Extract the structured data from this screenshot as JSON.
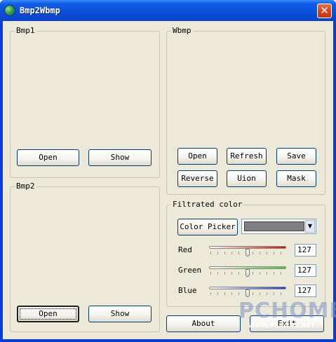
{
  "window": {
    "title": "Bmp2Wbmp",
    "close_glyph": "✕"
  },
  "bmp1": {
    "label": "Bmp1",
    "open_label": "Open",
    "show_label": "Show"
  },
  "bmp2": {
    "label": "Bmp2",
    "open_label": "Open",
    "show_label": "Show"
  },
  "wbmp": {
    "label": "Wbmp",
    "open_label": "Open",
    "refresh_label": "Refresh",
    "save_label": "Save",
    "reverse_label": "Reverse",
    "union_label": "Uion",
    "mask_label": "Mask"
  },
  "filter": {
    "label": "Filtrated color",
    "color_picker_label": "Color Picker",
    "swatch_color": "#808080",
    "dropdown_glyph": "▼",
    "red": {
      "label": "Red",
      "value": "127",
      "level": 0.5
    },
    "green": {
      "label": "Green",
      "value": "127",
      "level": 0.5
    },
    "blue": {
      "label": "Blue",
      "value": "127",
      "level": 0.5
    }
  },
  "footer": {
    "about_label": "About",
    "exit_label": "Exit"
  },
  "watermark": {
    "text": "PCHOME",
    "url": "WWW.PCHOME.NET"
  },
  "colors": {
    "face": "#ece9d8",
    "titlebar": "#0a4fd7",
    "close": "#d6451f"
  }
}
